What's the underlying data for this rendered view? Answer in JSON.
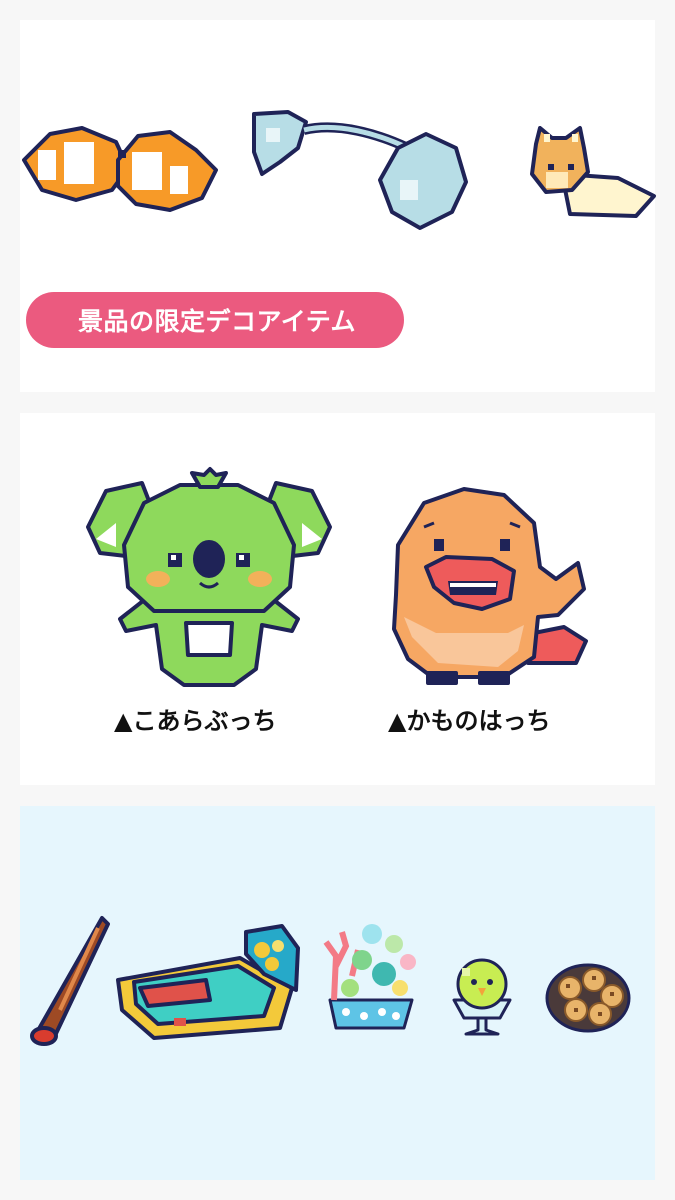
{
  "top_section": {
    "badge_label": "景品の限定デコアイテム",
    "items": [
      "clownfish-pair",
      "ghost-spirit",
      "squirrel-blanket"
    ]
  },
  "characters": [
    {
      "caption": "▲こあらぶっち",
      "icon": "koala-character"
    },
    {
      "caption": "▲かものはっち",
      "icon": "platypus-character"
    }
  ],
  "bottom_section": {
    "items": [
      "didgeridoo",
      "pool-bed",
      "coral-aquarium",
      "parakeet-dessert",
      "cookie-bowl"
    ]
  },
  "colors": {
    "badge": "#eb5a7f",
    "bottom_panel": "#e6f6fd",
    "koala_green": "#8ed95c",
    "platypus_orange": "#f6a763"
  }
}
